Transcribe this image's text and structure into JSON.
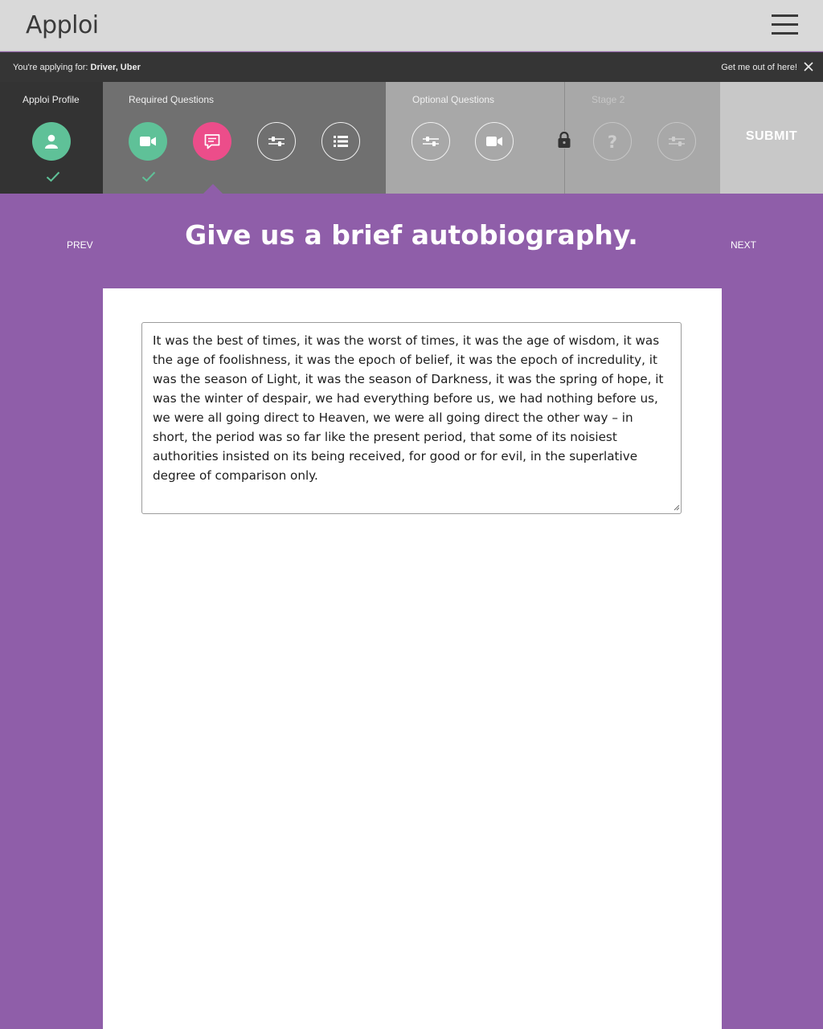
{
  "header": {
    "logo": "Apploi",
    "menu_icon": "hamburger-menu-icon"
  },
  "apply_bar": {
    "prefix": "You're applying for:",
    "job": "Driver, Uber",
    "exit": "Get me out of here!",
    "close_icon": "close-icon"
  },
  "steps": {
    "profile": {
      "title": "Apploi Profile",
      "icon": "user-icon",
      "complete": true
    },
    "required": {
      "title": "Required Questions",
      "items": [
        {
          "icon": "video-camera-icon",
          "state": "done"
        },
        {
          "icon": "text-message-icon",
          "state": "active"
        },
        {
          "icon": "sliders-icon",
          "state": "pending"
        },
        {
          "icon": "list-icon",
          "state": "pending"
        }
      ]
    },
    "optional": {
      "title": "Optional Questions",
      "items": [
        {
          "icon": "sliders-icon",
          "state": "pending"
        },
        {
          "icon": "video-camera-icon",
          "state": "pending"
        }
      ]
    },
    "stage2": {
      "title": "Stage 2",
      "lock_icon": "lock-icon",
      "items": [
        {
          "icon": "question-mark-icon",
          "state": "locked"
        },
        {
          "icon": "sliders-icon",
          "state": "locked"
        }
      ]
    },
    "submit": "SUBMIT"
  },
  "question": {
    "prev": "PREV",
    "next": "NEXT",
    "title": "Give us a brief autobiography.",
    "answer": "It was the best of times, it was the worst of times, it was the age of wisdom, it was the age of foolishness, it was the epoch of belief, it was the epoch of incredulity, it was the season of Light, it was the season of Darkness, it was the spring of hope, it was the winter of despair, we had everything before us, we had nothing before us, we were all going direct to Heaven, we were all going direct the other way – in short, the period was so far like the present period, that some of its noisiest authorities insisted on its being received, for good or for evil, in the superlative degree of comparison only."
  },
  "colors": {
    "purple": "#8f5ea9",
    "done_green": "#5fc198",
    "active_pink": "#ec4d8a"
  }
}
